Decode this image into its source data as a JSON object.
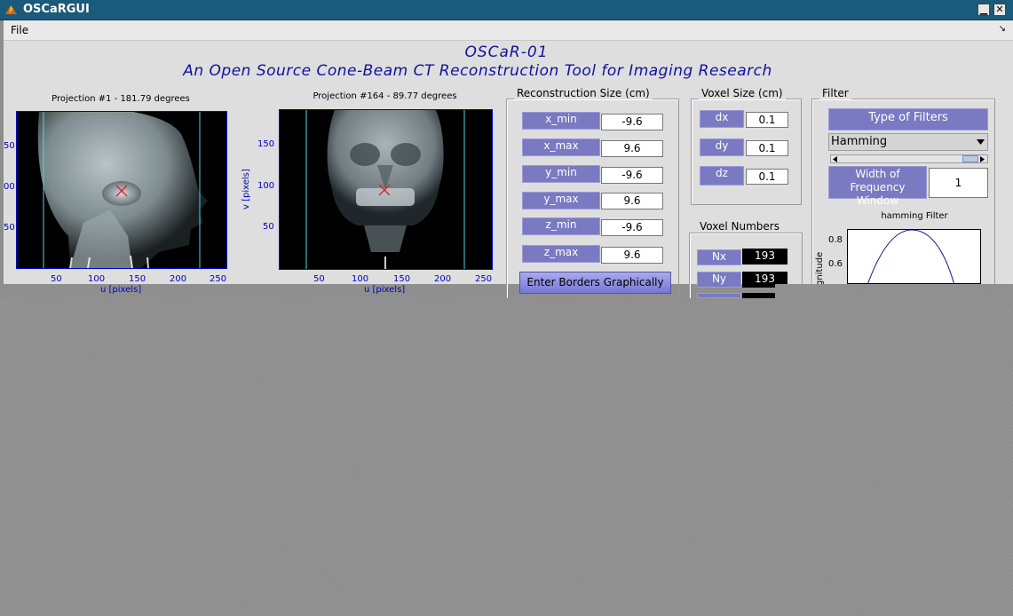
{
  "window": {
    "title": "OSCaRGUI",
    "min_glyph": "▁",
    "close_glyph": "✕"
  },
  "menu": {
    "file": "File",
    "corner_glyph": "↘"
  },
  "heading": {
    "line1": "OSCaR-01",
    "line2": "An Open Source Cone-Beam CT Reconstruction Tool for Imaging Research"
  },
  "plot1": {
    "title": "Projection #1 - 181.79 degrees",
    "x_ticks": [
      "50",
      "100",
      "150",
      "200",
      "250"
    ],
    "y_ticks": [
      "50",
      "00",
      "50"
    ],
    "xlabel": "u [pixels]"
  },
  "plot2": {
    "title": "Projection #164 - 89.77 degrees",
    "x_ticks": [
      "50",
      "100",
      "150",
      "200",
      "250"
    ],
    "y_ticks": [
      "150",
      "100",
      "50"
    ],
    "xlabel": "u [pixels]",
    "ylabel": "v [pixels]"
  },
  "recon": {
    "title": "Reconstruction Size (cm)",
    "rows": [
      {
        "label": "x_min",
        "value": "-9.6"
      },
      {
        "label": "x_max",
        "value": "9.6"
      },
      {
        "label": "y_min",
        "value": "-9.6"
      },
      {
        "label": "y_max",
        "value": "9.6"
      },
      {
        "label": "z_min",
        "value": "-9.6"
      },
      {
        "label": "z_max",
        "value": "9.6"
      }
    ],
    "button": "Enter Borders Graphically"
  },
  "voxel_size": {
    "title": "Voxel Size (cm)",
    "rows": [
      {
        "label": "dx",
        "value": "0.1"
      },
      {
        "label": "dy",
        "value": "0.1"
      },
      {
        "label": "dz",
        "value": "0.1"
      }
    ]
  },
  "voxel_numbers": {
    "title": "Voxel Numbers",
    "rows": [
      {
        "label": "Nx",
        "value": "193"
      },
      {
        "label": "Ny",
        "value": "193"
      }
    ]
  },
  "filter": {
    "title": "Filter",
    "type_label": "Type of Filters",
    "selected": "Hamming",
    "width_label": "Width of Frequency Window",
    "width_value": "1",
    "plot_title": "hamming Filter",
    "y_ticks": [
      "0.8",
      "0.6"
    ],
    "ylabel": "gnitude"
  },
  "colors": {
    "accent": "#7a7ac2",
    "title_bar": "#1a5a7a",
    "heading": "#1010a0",
    "marker": "#e02020"
  }
}
